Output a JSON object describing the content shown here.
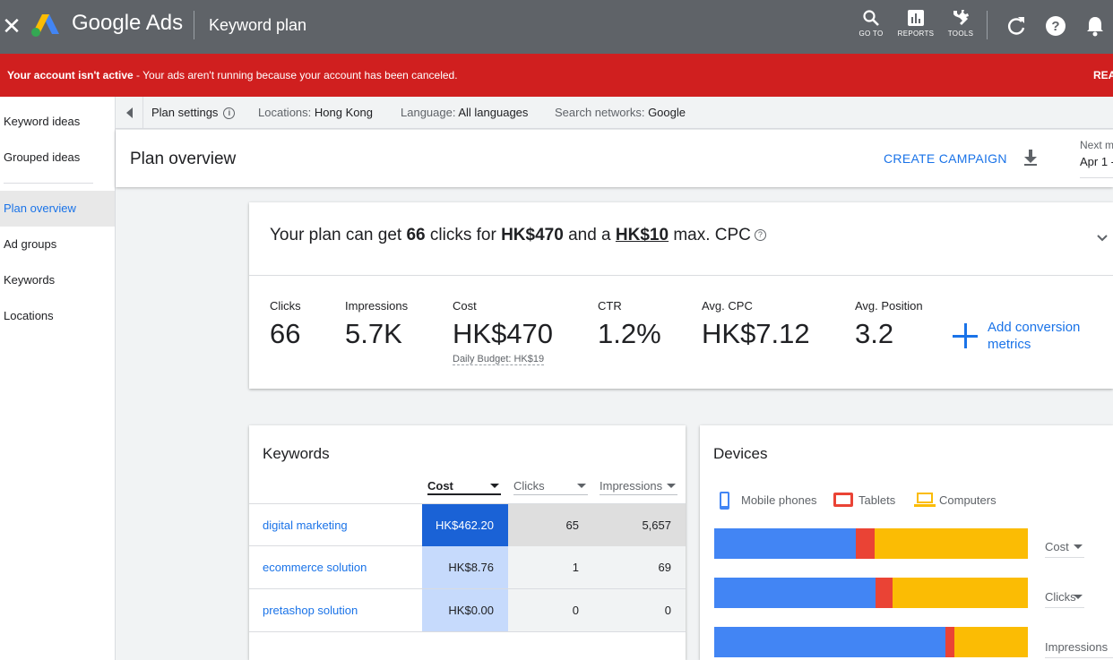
{
  "topbar": {
    "brand": "Google Ads",
    "title": "Keyword plan",
    "buttons": [
      {
        "label": "GO TO",
        "icon": "search-icon"
      },
      {
        "label": "REPORTS",
        "icon": "reports-icon"
      },
      {
        "label": "TOOLS",
        "icon": "tools-icon"
      }
    ],
    "icons": [
      "refresh-icon",
      "help-icon",
      "bell-icon"
    ]
  },
  "alert": {
    "bold": "Your account isn't active",
    "message": " - Your ads aren't running because your account has been canceled.",
    "action": "REA"
  },
  "nav": {
    "items": [
      {
        "label": "Keyword ideas"
      },
      {
        "label": "Grouped ideas"
      },
      {
        "label": "Plan overview",
        "active": true
      },
      {
        "label": "Ad groups"
      },
      {
        "label": "Keywords"
      },
      {
        "label": "Locations"
      }
    ]
  },
  "settings": {
    "plan_settings": "Plan settings",
    "locations_label": "Locations:",
    "locations_value": "Hong Kong",
    "language_label": "Language:",
    "language_value": "All languages",
    "networks_label": "Search networks:",
    "networks_value": "Google"
  },
  "plan_header": {
    "title": "Plan overview",
    "create_campaign": "CREATE CAMPAIGN",
    "date_label": "Next m",
    "date_value": "Apr 1 -"
  },
  "summary": {
    "part1": "Your plan can get ",
    "clicks": "66",
    "part2": " clicks for ",
    "cost": "HK$470",
    "part3": " and a ",
    "max_cpc": "HK$10",
    "part4": " max. CPC",
    "metrics": [
      {
        "label": "Clicks",
        "value": "66"
      },
      {
        "label": "Impressions",
        "value": "5.7K"
      },
      {
        "label": "Cost",
        "value": "HK$470",
        "sub": "Daily Budget: HK$19"
      },
      {
        "label": "CTR",
        "value": "1.2%"
      },
      {
        "label": "Avg. CPC",
        "value": "HK$7.12"
      },
      {
        "label": "Avg. Position",
        "value": "3.2"
      }
    ],
    "add_conversion": "Add conversion metrics"
  },
  "keywords": {
    "title": "Keywords",
    "columns": [
      "Cost",
      "Clicks",
      "Impressions"
    ],
    "rows": [
      {
        "keyword": "digital marketing",
        "cost": "HK$462.20",
        "clicks": "65",
        "impressions": "5,657"
      },
      {
        "keyword": "ecommerce solution",
        "cost": "HK$8.76",
        "clicks": "1",
        "impressions": "69"
      },
      {
        "keyword": "pretashop solution",
        "cost": "HK$0.00",
        "clicks": "0",
        "impressions": "0"
      }
    ]
  },
  "devices": {
    "title": "Devices",
    "legend": [
      {
        "label": "Mobile phones",
        "color": "#4285f4",
        "icon": "mobile-phone-icon"
      },
      {
        "label": "Tablets",
        "color": "#ea4335",
        "icon": "tablet-icon"
      },
      {
        "label": "Computers",
        "color": "#fbbc04",
        "icon": "computer-icon"
      }
    ],
    "bars": [
      {
        "metric": "Cost",
        "mobile": 45.1,
        "tablet": 6.0,
        "computers": 48.9
      },
      {
        "metric": "Clicks",
        "mobile": 51.4,
        "tablet": 5.4,
        "computers": 43.2
      },
      {
        "metric": "Impressions",
        "mobile": 73.7,
        "tablet": 2.9,
        "computers": 23.4
      }
    ]
  },
  "colors": {
    "topbar": "#5f6368",
    "alert": "#d01f1f",
    "accent": "#1a73e8",
    "cost_top": "#1a62d6",
    "cost_light": "#c6dafc"
  }
}
